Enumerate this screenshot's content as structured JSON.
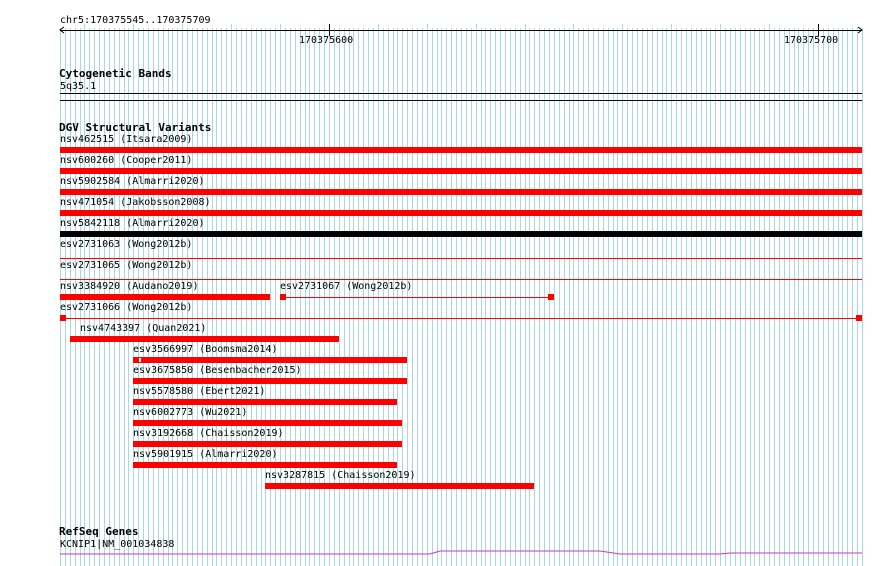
{
  "position": {
    "range_label": "chr5:170375545..170375709",
    "start": 170375545,
    "end": 170375709,
    "ticks": [
      {
        "value": 170375600,
        "label": "170375600"
      },
      {
        "value": 170375700,
        "label": "170375700"
      }
    ]
  },
  "tracks": {
    "cytoband": {
      "title": "Cytogenetic Bands",
      "band": "5q35.1"
    },
    "dgv": {
      "title": "DGV Structural Variants",
      "variants": [
        {
          "label": "nsv462515 (Itsara2009)",
          "start": 170375545,
          "end": 170375709,
          "style": "bar",
          "color": "#ff0000",
          "row": 0
        },
        {
          "label": "nsv600260 (Cooper2011)",
          "start": 170375545,
          "end": 170375709,
          "style": "bar",
          "color": "#ff0000",
          "row": 1
        },
        {
          "label": "nsv5902584 (Almarri2020)",
          "start": 170375545,
          "end": 170375709,
          "style": "bar",
          "color": "#ff0000",
          "row": 2
        },
        {
          "label": "nsv471054 (Jakobsson2008)",
          "start": 170375545,
          "end": 170375709,
          "style": "bar",
          "color": "#ff0000",
          "row": 3
        },
        {
          "label": "nsv5842118 (Almarri2020)",
          "start": 170375545,
          "end": 170375709,
          "style": "bar",
          "color": "#000000",
          "row": 4
        },
        {
          "label": "esv2731063 (Wong2012b)",
          "start": 170375545,
          "end": 170375709,
          "style": "line",
          "color": "#ff0000",
          "row": 5
        },
        {
          "label": "esv2731065 (Wong2012b)",
          "start": 170375545,
          "end": 170375709,
          "style": "line",
          "color": "#ff0000",
          "row": 6
        },
        {
          "label": "nsv3384920 (Audano2019)",
          "start": 170375545,
          "end": 170375588,
          "style": "bar",
          "color": "#ff0000",
          "row": 7
        },
        {
          "label": "esv2731067 (Wong2012b)",
          "start": 170375590,
          "end": 170375646,
          "style": "gapped",
          "color": "#ff0000",
          "row": 7
        },
        {
          "label": "esv2731066 (Wong2012b)",
          "start": 170375545,
          "end": 170375709,
          "style": "gapped",
          "color": "#ff0000",
          "row": 8
        },
        {
          "label": "nsv4743397 (Quan2021)",
          "start": 170375547,
          "end": 170375602,
          "style": "bar",
          "color": "#ff0000",
          "row": 9
        },
        {
          "label": "esv3566997 (Boomsma2014)",
          "start": 170375560,
          "end": 170375616,
          "style": "bar",
          "color": "#ff0000",
          "row": 10,
          "notch": true
        },
        {
          "label": "esv3675850 (Besenbacher2015)",
          "start": 170375560,
          "end": 170375616,
          "style": "bar",
          "color": "#ff0000",
          "row": 11
        },
        {
          "label": "nsv5578580 (Ebert2021)",
          "start": 170375560,
          "end": 170375614,
          "style": "bar",
          "color": "#ff0000",
          "row": 12
        },
        {
          "label": "nsv6002773 (Wu2021)",
          "start": 170375560,
          "end": 170375615,
          "style": "bar",
          "color": "#ff0000",
          "row": 13
        },
        {
          "label": "nsv3192668 (Chaisson2019)",
          "start": 170375560,
          "end": 170375615,
          "style": "bar",
          "color": "#ff0000",
          "row": 14
        },
        {
          "label": "nsv5901915 (Almarri2020)",
          "start": 170375560,
          "end": 170375614,
          "style": "bar",
          "color": "#ff0000",
          "row": 15
        },
        {
          "label": "nsv3287815 (Chaisson2019)",
          "start": 170375587,
          "end": 170375642,
          "style": "bar",
          "color": "#ff0000",
          "row": 16
        }
      ]
    },
    "refseq": {
      "title": "RefSeq Genes",
      "gene_label": "KCNIP1|NM_001034838",
      "color": "#cc33cc"
    }
  },
  "colors": {
    "grid": "#a8d8e0",
    "accent": "#ff0000"
  }
}
